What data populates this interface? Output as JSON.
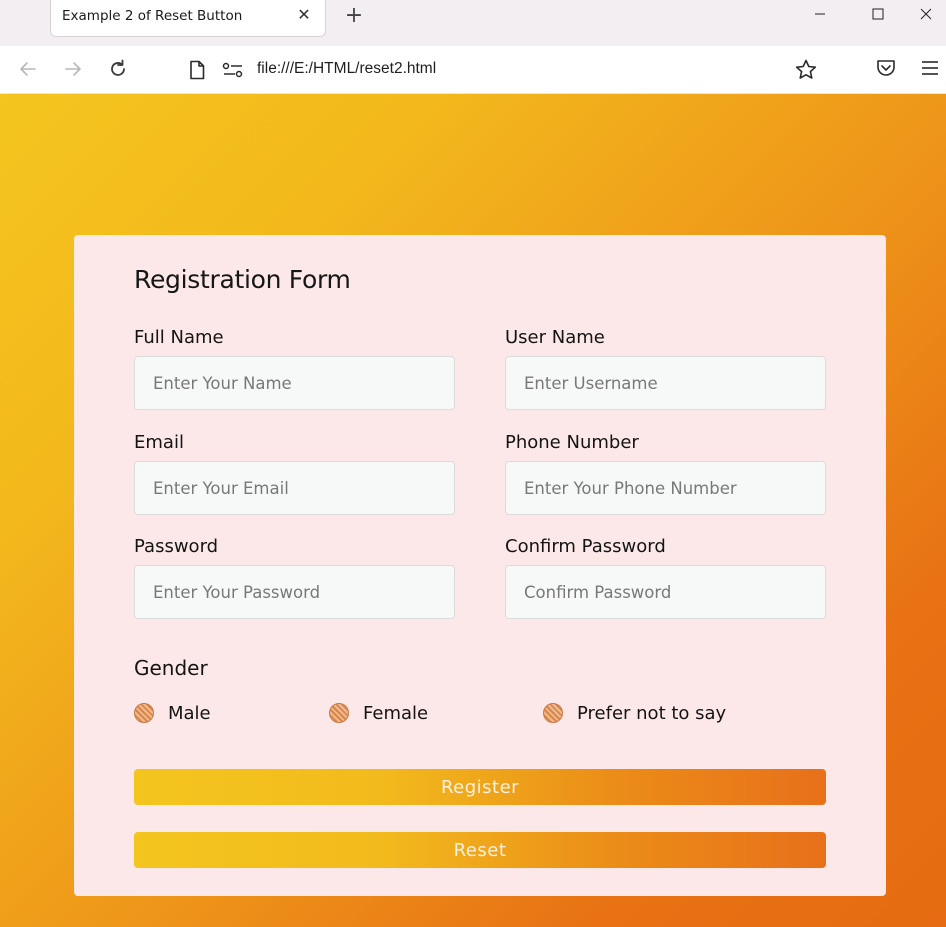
{
  "browser": {
    "tab_title": "Example 2 of Reset Button",
    "tab_close": "✕",
    "new_tab": "+",
    "url": "file:///E:/HTML/reset2.html",
    "icons": [
      "back-icon",
      "forward-icon",
      "reload-icon",
      "page-icon",
      "permissions-icon",
      "star-icon",
      "pocket-icon",
      "menu-icon"
    ]
  },
  "form": {
    "title": "Registration Form",
    "fields": {
      "full_name": {
        "label": "Full Name",
        "placeholder": "Enter Your Name",
        "value": ""
      },
      "user_name": {
        "label": "User Name",
        "placeholder": "Enter Username",
        "value": ""
      },
      "email": {
        "label": "Email",
        "placeholder": "Enter Your Email",
        "value": ""
      },
      "phone": {
        "label": "Phone Number",
        "placeholder": "Enter Your Phone Number",
        "value": ""
      },
      "password": {
        "label": "Password",
        "placeholder": "Enter Your Password",
        "value": ""
      },
      "confirm_password": {
        "label": "Confirm Password",
        "placeholder": "Confirm Password",
        "value": ""
      }
    },
    "gender": {
      "title": "Gender",
      "options": [
        "Male",
        "Female",
        "Prefer not to say"
      ]
    },
    "register_label": "Register",
    "reset_label": "Reset"
  },
  "colors": {
    "gradient_start": "#f4c51e",
    "gradient_end": "#e66b12",
    "card_background": "#fce8e8",
    "input_background": "#f7f9f9"
  }
}
